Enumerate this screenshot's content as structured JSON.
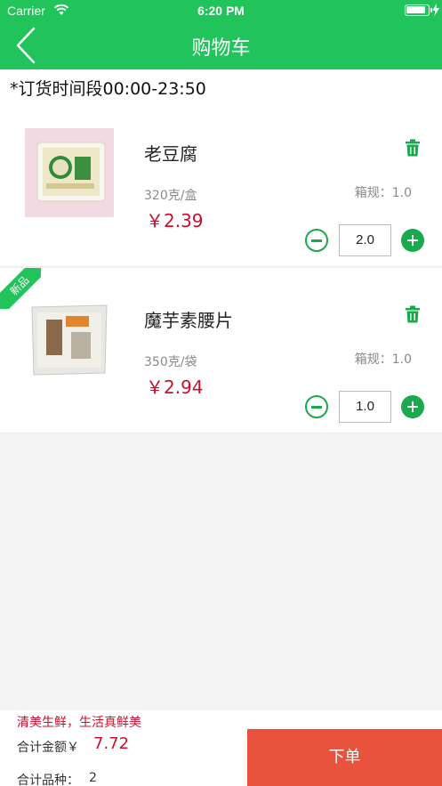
{
  "status_bar": {
    "carrier": "Carrier",
    "time": "6:20 PM"
  },
  "nav": {
    "title": "购物车",
    "icons": [
      "back-chevron-icon"
    ]
  },
  "notice": "*订货时间段00:00-23:50",
  "items": [
    {
      "name": "老豆腐",
      "spec": "320克/盒",
      "price": "￥2.39",
      "box_spec": "箱规：1.0",
      "quantity": "2.0",
      "is_new": false,
      "image": "tofu-package"
    },
    {
      "name": "魔芋素腰片",
      "spec": "350克/袋",
      "price": "￥2.94",
      "box_spec": "箱规：1.0",
      "quantity": "1.0",
      "is_new": true,
      "new_badge": "新品",
      "image": "konjac-package"
    }
  ],
  "footer": {
    "slogan": "清美生鲜，生活真鲜美",
    "total_label": "合计金额￥",
    "total_value": "7.72",
    "kinds_label": "合计品种：",
    "kinds_value": "2",
    "order_button": "下单"
  },
  "colors": {
    "brand_green": "#21c45a",
    "price_red": "#c8102e",
    "order_button": "#e9533e"
  }
}
